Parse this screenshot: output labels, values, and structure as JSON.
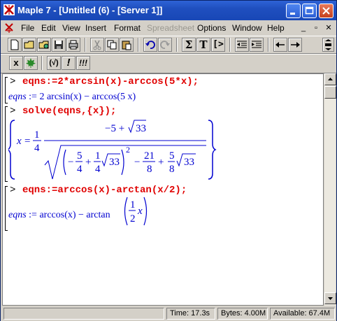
{
  "window": {
    "title": "Maple 7  - [Untitled (6) - [Server 1]]"
  },
  "menubar": {
    "items": [
      {
        "label": "File",
        "enabled": true
      },
      {
        "label": "Edit",
        "enabled": true
      },
      {
        "label": "View",
        "enabled": true
      },
      {
        "label": "Insert",
        "enabled": true
      },
      {
        "label": "Format",
        "enabled": true
      },
      {
        "label": "Spreadsheet",
        "enabled": false
      },
      {
        "label": "Options",
        "enabled": true
      },
      {
        "label": "Window",
        "enabled": true
      },
      {
        "label": "Help",
        "enabled": true
      }
    ]
  },
  "toolbar": {
    "sum_label": "Σ",
    "text_label": "T",
    "prompt_label": "[>",
    "exclaim_label": "!",
    "triple_exclaim_label": "!!!",
    "x_label": "x",
    "sqrt_label": "(√)"
  },
  "worksheet": {
    "prompt": ">",
    "lines": [
      {
        "kind": "input",
        "text": "eqns:=2*arcsin(x)-arccos(5*x);"
      },
      {
        "kind": "output",
        "lhs": "eqns",
        "rhs": ":= 2 arcsin(x) − arccos(5 x)"
      },
      {
        "kind": "input",
        "text": "solve(eqns,{x});"
      },
      {
        "kind": "input",
        "text": "eqns:=arccos(x)-arctan(x/2);"
      },
      {
        "kind": "output",
        "lhs": "eqns",
        "rhs": ":= arccos(x) − arctan"
      }
    ],
    "solution": {
      "var": "x",
      "eq": "=",
      "coef_num": "1",
      "coef_den": "4",
      "numerator": "−5 +",
      "radicand": "33",
      "power": "2",
      "term1_sign": "−",
      "frac_a_num": "5",
      "frac_a_den": "4",
      "plus": "+",
      "frac_b_num": "1",
      "frac_b_den": "4",
      "minus": "−",
      "frac_c_num": "21",
      "frac_c_den": "8",
      "plus2": "+",
      "frac_d_num": "5",
      "frac_d_den": "8"
    },
    "second_arg": {
      "num": "1",
      "den": "2",
      "var": "x"
    }
  },
  "statusbar": {
    "time": "Time:  17.3s",
    "bytes": "Bytes: 4.00M",
    "available": "Available: 67.4M"
  },
  "colors": {
    "input": "#e00000",
    "output": "#0000d0",
    "titlebar": "#1f4fbf"
  }
}
